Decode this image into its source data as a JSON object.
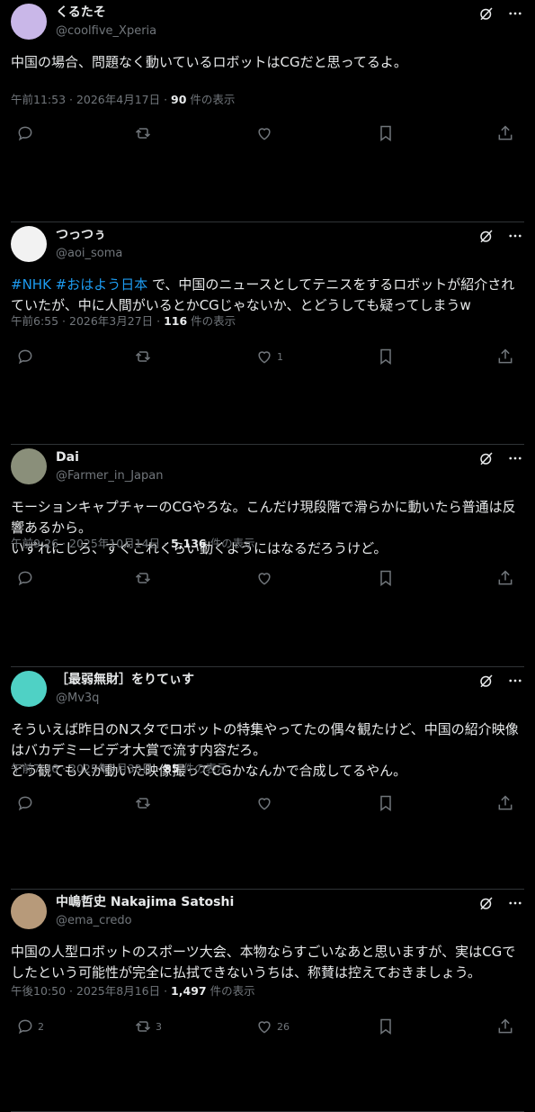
{
  "posts": [
    {
      "name": "くるたそ",
      "handle": "@coolfive_Xperia",
      "text": "中国の場合、問題なく動いているロボットはCGだと思ってるよ。",
      "time": "午前11:53 · 2026年4月17日 · ",
      "views": "90",
      "views_suffix": " 件の表示",
      "counts": {
        "reply": "",
        "repost": "",
        "like": ""
      },
      "avatar_color": "#c9b7e8"
    },
    {
      "name": "つっつぅ",
      "handle": "@aoi_soma",
      "tags": "#NHK #おはよう日本",
      "text": " で、中国のニュースとしてテニスをするロボットが紹介されていたが、中に人間がいるとかCGじゃないか、とどうしても疑ってしまうw",
      "time": "午前6:55 · 2026年3月27日 · ",
      "views": "116",
      "views_suffix": " 件の表示",
      "counts": {
        "reply": "",
        "repost": "",
        "like": "1"
      },
      "avatar_color": "#f2f2f2"
    },
    {
      "name": "Dai",
      "handle": "@Farmer_in_Japan",
      "text": "モーションキャプチャーのCGやろな。こんだけ現段階で滑らかに動いたら普通は反響あるから。\nいずれにしろ、すぐこれくらい動くようにはなるだろうけど。",
      "time": "午前9:26 · 2025年10月14日 · ",
      "views": "5,136",
      "views_suffix": " 件の表示",
      "counts": {
        "reply": "",
        "repost": "",
        "like": ""
      },
      "avatar_color": "#8a8f7a"
    },
    {
      "name": "［最弱無財］をりてぃす",
      "handle": "@Mv3q",
      "text": "そういえば昨日のNスタでロボットの特集やってたの偶々観たけど、中国の紹介映像はバカデミービデオ大賞で流す内容だろ。\nどう観ても人が動いた映像撮ってCGかなんかで合成してるやん。",
      "time": "午前7:46 · 2025年9月30日 · ",
      "views": "85",
      "views_suffix": " 件の表示",
      "counts": {
        "reply": "",
        "repost": "",
        "like": ""
      },
      "avatar_color": "#4fd1c5"
    },
    {
      "name": "中嶋哲史 Nakajima Satoshi",
      "handle": "@ema_credo",
      "text": "中国の人型ロボットのスポーツ大会、本物ならすごいなあと思いますが、実はCGでしたという可能性が完全に払拭できないうちは、称賛は控えておきましょう。",
      "time": "午後10:50 · 2025年8月16日 · ",
      "views": "1,497",
      "views_suffix": " 件の表示",
      "counts": {
        "reply": "2",
        "repost": "3",
        "like": "26"
      },
      "avatar_color": "#b79a7a"
    }
  ],
  "colors": {
    "background": "#000000",
    "text": "#e7e9ea",
    "muted": "#71767b",
    "link": "#1d9bf0",
    "divider": "#2f3336"
  }
}
